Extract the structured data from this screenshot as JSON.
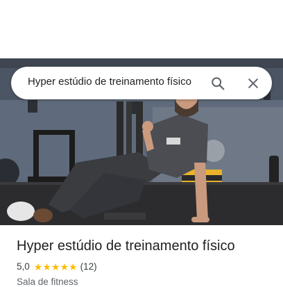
{
  "search": {
    "query": "Hyper estúdio de treinamento físico",
    "search_icon": "search-icon",
    "close_icon": "close-icon"
  },
  "place": {
    "name": "Hyper estúdio de treinamento físico",
    "rating": "5,0",
    "rating_value": 5,
    "stars": [
      "★",
      "★",
      "★",
      "★",
      "★"
    ],
    "review_count": "(12)",
    "category": "Sala de fitness"
  },
  "colors": {
    "star": "#fbbc04",
    "text_primary": "#202124",
    "text_secondary": "#5f6368"
  }
}
